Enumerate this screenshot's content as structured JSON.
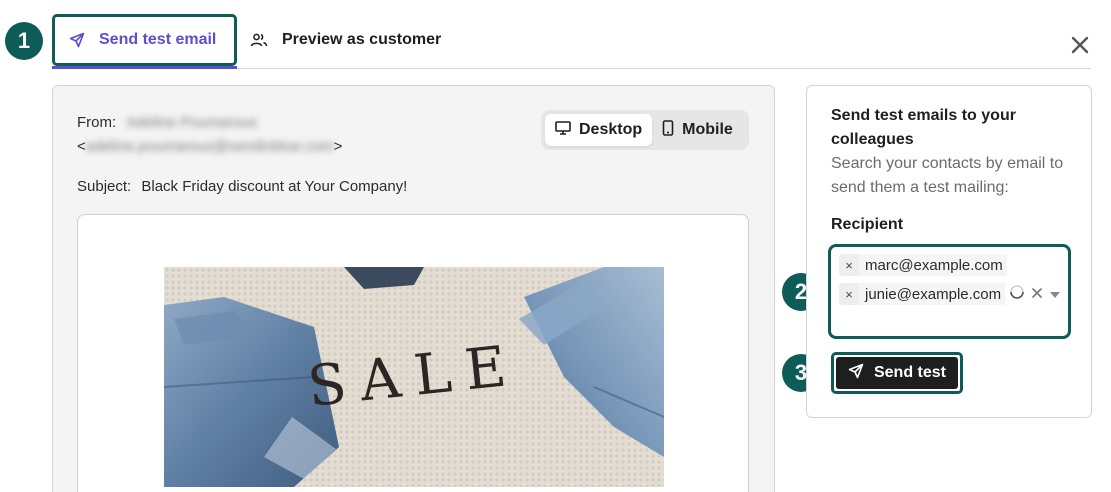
{
  "steps": [
    "1",
    "2",
    "3"
  ],
  "tabs": {
    "send_test": "Send test email",
    "preview_customer": "Preview as customer"
  },
  "preview": {
    "from_label": "From:",
    "from_name": "Adeline Poumarous",
    "from_address_open": "<",
    "from_address": "adeline.poumarous@sendinblue.com",
    "from_address_close": ">",
    "subject_label": "Subject:",
    "subject_value": "Black Friday discount at Your Company!",
    "device_desktop": "Desktop",
    "device_mobile": "Mobile",
    "hero_text": "SALE"
  },
  "test_panel": {
    "title": "Send test emails to your colleagues",
    "description": "Search your contacts by email to send them a test mailing:",
    "recipient_label": "Recipient",
    "recipients": [
      "marc@example.com",
      "junie@example.com"
    ],
    "remove_symbol": "×",
    "send_button": "Send test"
  },
  "colors": {
    "accent_purple": "#5b4fd1",
    "highlight_teal": "#0d5c57",
    "button_dark": "#1e1e1e"
  }
}
